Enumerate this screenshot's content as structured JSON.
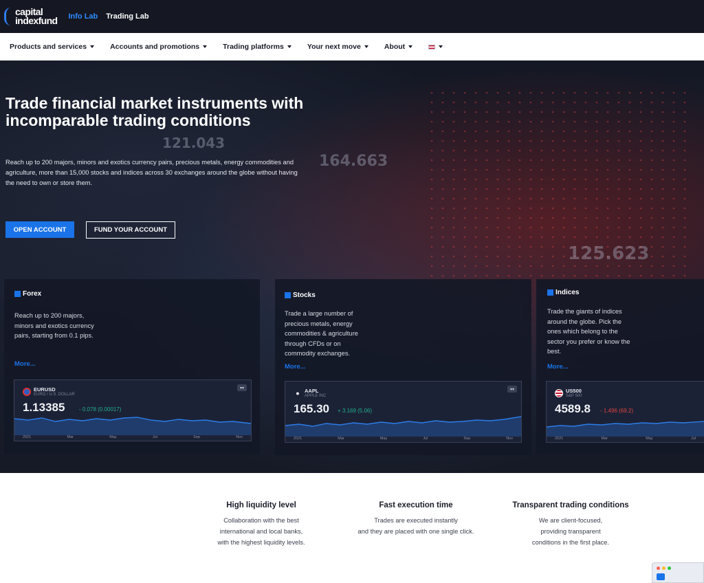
{
  "brand": {
    "logo_line1": "capital",
    "logo_line2": "indexfund"
  },
  "topbar": {
    "links": [
      "Info Lab",
      "Trading Lab"
    ]
  },
  "nav": {
    "items": [
      "Products and services",
      "Accounts and promotions",
      "Trading platforms",
      "Your next move",
      "About"
    ]
  },
  "hero": {
    "title": "Trade financial market instruments with incomparable trading conditions",
    "description": "Reach up to 200 majors, minors and exotics currency pairs, precious metals, energy commodities and agriculture, more than 15,000 stocks and indices across 30 exchanges around the globe without having the need to own or store them.",
    "open_account": "OPEN ACCOUNT",
    "fund_account": "FUND YOUR ACCOUNT",
    "bg_numbers": [
      "121.043",
      "164.663",
      "125.623"
    ]
  },
  "cards": [
    {
      "title": "Forex",
      "text": "Reach up to 200 majors, minors and exotics currency pairs, starting from 0.1 pips.",
      "more": "More...",
      "widget": {
        "symbol": "EURUSD",
        "subtitle": "EURO / U.S. DOLLAR",
        "price": "1.13385",
        "change": "- 0.078 (0.00017)",
        "change_color": "#1eae8a",
        "axis": [
          "2021",
          "Mar",
          "May",
          "Jul",
          "Sep",
          "Nov"
        ]
      }
    },
    {
      "title": "Stocks",
      "text": "Trade a large number of precious metals, energy commodities & agriculture through CFDs or on commodity exchanges.",
      "more": "More...",
      "widget": {
        "symbol": "AAPL",
        "subtitle": "APPLE INC",
        "price": "165.30",
        "change": "+ 3.169 (5.06)",
        "change_color": "#1eae8a",
        "axis": [
          "2021",
          "Mar",
          "May",
          "Jul",
          "Sep",
          "Nov"
        ]
      }
    },
    {
      "title": "Indices",
      "text": "Trade the giants of indices around the globe. Pick the ones which belong to the sector you prefer or know the best.",
      "more": "More...",
      "widget": {
        "symbol": "US500",
        "subtitle": "S&P 500",
        "price": "4589.8",
        "change": "- 1.496 (69.2)",
        "change_color": "#e0443c",
        "axis": [
          "2021",
          "Mar",
          "May",
          "Jul"
        ]
      }
    }
  ],
  "features": [
    {
      "title": "High liquidity level",
      "text": [
        "Collaboration with the best",
        "international and local banks,",
        "with the highest liquidity levels."
      ]
    },
    {
      "title": "Fast execution time",
      "text": [
        "Trades are executed instantly",
        "and they are placed with one single click."
      ]
    },
    {
      "title": "Transparent trading conditions",
      "text": [
        "We are client-focused,",
        "providing transparent",
        "conditions in the first place."
      ]
    }
  ]
}
